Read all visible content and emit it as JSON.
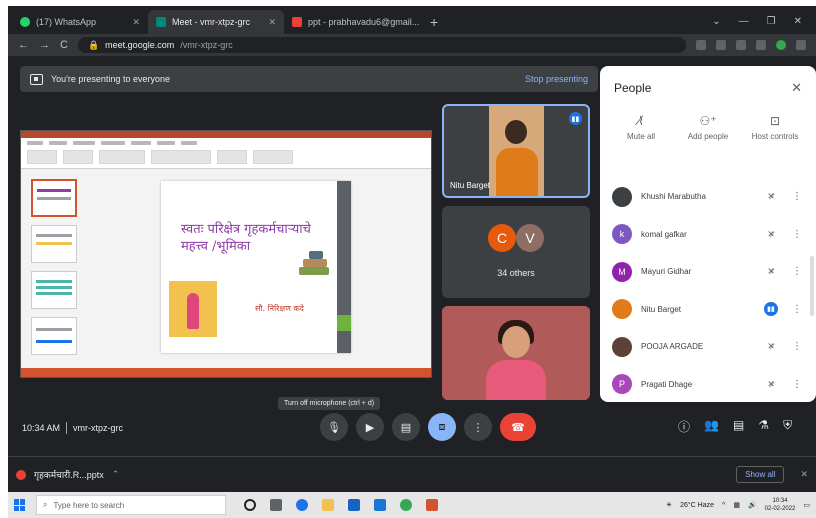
{
  "browser": {
    "tabs": [
      {
        "title": "(17) WhatsApp",
        "color": "#25d366"
      },
      {
        "title": "Meet - vmr-xtpz-grc",
        "color": "#00897b"
      },
      {
        "title": "ppt - prabhavadu6@gmail...",
        "color": "#ea4335"
      }
    ],
    "new_tab": "+",
    "window_controls": [
      "⌄",
      "—",
      "❐",
      "✕"
    ],
    "address": {
      "host": "meet.google.com",
      "path": "/vmr-xtpz-grc"
    }
  },
  "meet": {
    "presenting_text": "You're presenting to everyone",
    "stop_presenting": "Stop presenting",
    "slide": {
      "title": "स्वतः परिक्षेत्र गृहकर्मचाऱ्याचे महत्त्व /भूमिका",
      "author": "सौ. निरिक्षण कदे"
    },
    "tiles": {
      "nitu_name": "Nitu Barget",
      "others_avatars": [
        "C",
        "V"
      ],
      "others_label": "34 others"
    },
    "tooltip": "Turn off microphone (ctrl + d)",
    "time": "10:34 AM",
    "meeting_code": "vmr-xtpz-grc"
  },
  "people_panel": {
    "title": "People",
    "close": "✕",
    "actions": [
      {
        "label": "Mute all",
        "icon": "mic-off-icon",
        "glyph": "🎙"
      },
      {
        "label": "Add people",
        "icon": "person-add-icon",
        "glyph": "👤"
      },
      {
        "label": "Host controls",
        "icon": "host-controls-icon",
        "glyph": "⚿"
      }
    ],
    "participants": [
      {
        "name": "Khushi Marabutha",
        "avatar": "",
        "color": "#3c4043",
        "mic": "muted"
      },
      {
        "name": "komal gafkar",
        "avatar": "k",
        "color": "#7e57c2",
        "mic": "muted"
      },
      {
        "name": "Mayuri Gidhar",
        "avatar": "M",
        "color": "#8e24aa",
        "mic": "muted"
      },
      {
        "name": "Nitu Barget",
        "avatar": "",
        "color": "#e07b1a",
        "mic": "speaking"
      },
      {
        "name": "POOJA ARGADE",
        "avatar": "",
        "color": "#5d4037",
        "mic": "muted"
      },
      {
        "name": "Pragati Dhage",
        "avatar": "P",
        "color": "#ab47bc",
        "mic": "muted"
      }
    ]
  },
  "downloads": {
    "file": "गृहकर्मचारी.R...pptx",
    "show_all": "Show all"
  },
  "taskbar": {
    "search_placeholder": "Type here to search",
    "weather": "26°C Haze",
    "time": "10:34",
    "date": "02-02-2022"
  },
  "colors": {
    "meet_bg": "#202124",
    "accent": "#8ab4f8",
    "end_call": "#ea4335",
    "ppt": "#d35230"
  }
}
